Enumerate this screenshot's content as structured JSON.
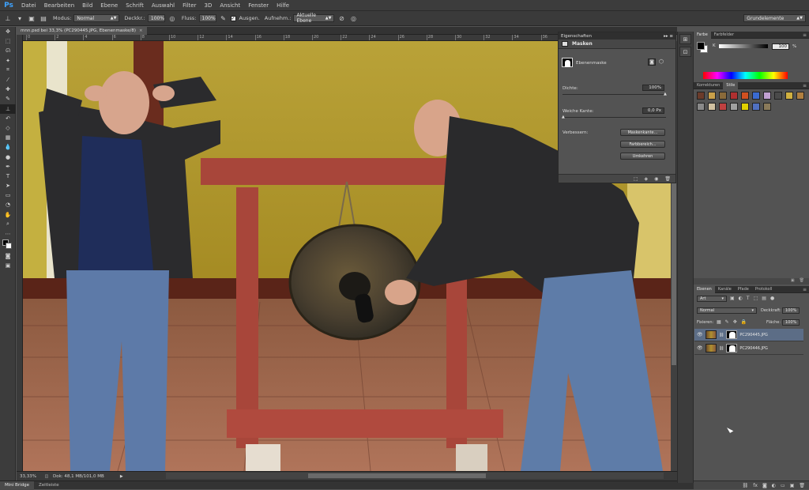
{
  "app": {
    "logo": "Ps"
  },
  "menu": [
    "Datei",
    "Bearbeiten",
    "Bild",
    "Ebene",
    "Schrift",
    "Auswahl",
    "Filter",
    "3D",
    "Ansicht",
    "Fenster",
    "Hilfe"
  ],
  "options": {
    "modus_label": "Modus:",
    "modus_value": "Normal",
    "deckkr_label": "Deckkr.:",
    "deckkr_value": "100%",
    "fluss_label": "Fluss:",
    "fluss_value": "100%",
    "ausgen_label": "Ausgen.",
    "aufnehm_label": "Aufnehm.:",
    "aufnehm_value": "Aktuelle Ebene",
    "workspace": "Grundelemente"
  },
  "document": {
    "tab_title": "mnn.psd bei 33,3% (PC290445.JPG, Ebenenmaske/8)",
    "ruler_ticks": [
      "0",
      "2",
      "4",
      "6",
      "8",
      "10",
      "12",
      "14",
      "16",
      "18",
      "20",
      "22",
      "24",
      "26",
      "28",
      "30",
      "32",
      "34",
      "36",
      "38",
      "40",
      "42",
      "44"
    ],
    "zoom": "33,33%",
    "doc_info": "Dok: 48,1 MB/101,0 MB"
  },
  "bottom_tabs": [
    "Mini Bridge",
    "Zeitleiste"
  ],
  "properties": {
    "header": "Eigenschaften",
    "section": "Masken",
    "mask_label": "Ebenenmaske",
    "dichte_label": "Dichte:",
    "dichte_value": "100%",
    "kante_label": "Weiche Kante:",
    "kante_value": "0,0 Px",
    "verbessern_label": "Verbessern:",
    "btn_maskenkante": "Maskenkante...",
    "btn_farbbereich": "Farbbereich...",
    "btn_umkehren": "Umkehren"
  },
  "color_panel": {
    "tabs": [
      "Farbe",
      "Farbfelder"
    ],
    "channel": "K",
    "value": "100",
    "unit": "%"
  },
  "styles_panel": {
    "tabs": [
      "Korrekturen",
      "Stile"
    ],
    "swatches": [
      "#6b3b2a",
      "#c9a04a",
      "#8a6a3a",
      "#b03030",
      "#d05020",
      "#3a6ad0",
      "#c0a0d0",
      "#4a4a4a",
      "#d0b040",
      "#b08040",
      "#8a8a8a",
      "#d0c0a0",
      "#c04040",
      "#a0a0a0",
      "#e0d000",
      "#5070c0",
      "#8a7a5a"
    ]
  },
  "layers_panel": {
    "tabs": [
      "Ebenen",
      "Kanäle",
      "Pfade",
      "Protokoll"
    ],
    "filter": "Art",
    "blend": "Normal",
    "deckkraft_label": "Deckkraft:",
    "deckkraft_value": "100%",
    "fixieren_label": "Fixieren:",
    "flaeche_label": "Fläche:",
    "flaeche_value": "100%",
    "layers": [
      {
        "name": "PC290445.JPG",
        "selected": true
      },
      {
        "name": "PC290446.JPG",
        "selected": false
      }
    ]
  }
}
